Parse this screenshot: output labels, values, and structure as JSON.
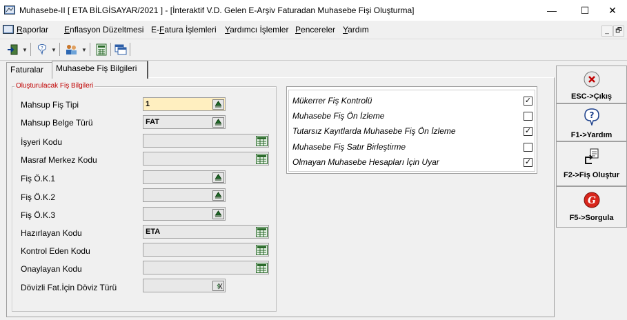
{
  "window": {
    "title": "Muhasebe-II [ ETA BİLGİSAYAR/2021 ] - [İnteraktif V.D. Gelen E-Arşiv Faturadan Muhasebe Fişi Oluşturma]",
    "minimize": "—",
    "maximize": "☐",
    "close": "✕"
  },
  "menu": {
    "items": [
      {
        "key": "R",
        "rest": "aporlar"
      },
      {
        "key": "E",
        "rest": "nflasyon Düzeltmesi"
      },
      {
        "pre": "E-",
        "key": "F",
        "rest": "atura İşlemleri"
      },
      {
        "key": "Y",
        "rest": "ardımcı İşlemler"
      },
      {
        "key": "P",
        "rest": "encereler"
      },
      {
        "key": "Y",
        "rest": "ardım"
      }
    ],
    "mdi_minimize": "_",
    "mdi_restore": "🗗"
  },
  "tabs": [
    {
      "label": "Faturalar"
    },
    {
      "label": "Muhasebe Fiş Bilgileri"
    }
  ],
  "group": {
    "legend": "Oluşturulacak Fiş Bilgileri",
    "fields": [
      {
        "label": "Mahsup Fiş Tipi",
        "value": "1"
      },
      {
        "label": "Mahsup Belge Türü",
        "value": "FAT"
      },
      {
        "label": "İşyeri Kodu",
        "value": ""
      },
      {
        "label": "Masraf Merkez Kodu",
        "value": ""
      },
      {
        "label": "Fiş Ö.K.1",
        "value": ""
      },
      {
        "label": "Fiş Ö.K.2",
        "value": ""
      },
      {
        "label": "Fiş Ö.K.3",
        "value": ""
      },
      {
        "label": "Hazırlayan Kodu",
        "value": "ETA"
      },
      {
        "label": "Kontrol Eden Kodu",
        "value": ""
      },
      {
        "label": "Onaylayan Kodu",
        "value": ""
      },
      {
        "label": "Dövizli Fat.İçin Döviz Türü",
        "value": ""
      }
    ]
  },
  "options": [
    {
      "label": "Mükerrer Fiş Kontrolü",
      "checked": true,
      "mark": "✓"
    },
    {
      "label": "Muhasebe Fiş Ön İzleme",
      "checked": false,
      "mark": ""
    },
    {
      "label": "Tutarsız Kayıtlarda Muhasebe Fiş Ön İzleme",
      "checked": true,
      "mark": "✓"
    },
    {
      "label": "Muhasebe Fiş Satır Birleştirme",
      "checked": false,
      "mark": ""
    },
    {
      "label": "Olmayan Muhasebe Hesapları İçin Uyar",
      "checked": true,
      "mark": "✓"
    }
  ],
  "side_buttons": [
    {
      "label": "ESC->Çıkış",
      "icon": "close-circle-icon"
    },
    {
      "label": "F1->Yardım",
      "icon": "help-bubble-icon"
    },
    {
      "label": "F2->Fiş Oluştur",
      "icon": "create-document-icon"
    },
    {
      "label": "F5->Sorgula",
      "icon": "query-icon"
    }
  ]
}
